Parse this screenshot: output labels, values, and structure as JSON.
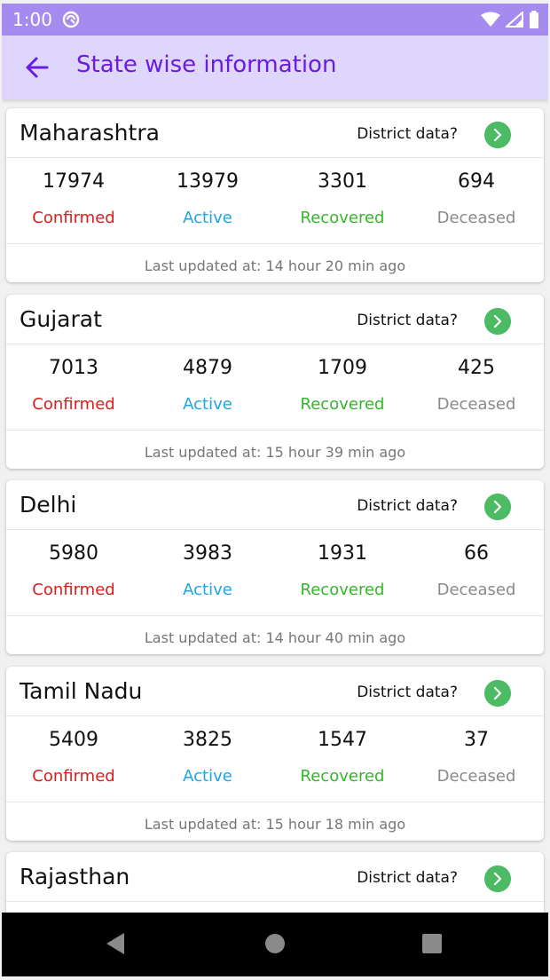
{
  "status_bar": {
    "time": "1:00"
  },
  "app_bar": {
    "title": "State wise information"
  },
  "district_label": "District data?",
  "stat_labels": {
    "confirmed": "Confirmed",
    "active": "Active",
    "recovered": "Recovered",
    "deceased": "Deceased"
  },
  "states": [
    {
      "name": "Maharashtra",
      "confirmed": "17974",
      "active": "13979",
      "recovered": "3301",
      "deceased": "694",
      "updated": "Last updated at: 14 hour 20 min ago"
    },
    {
      "name": "Gujarat",
      "confirmed": "7013",
      "active": "4879",
      "recovered": "1709",
      "deceased": "425",
      "updated": "Last updated at: 15 hour 39 min ago"
    },
    {
      "name": "Delhi",
      "confirmed": "5980",
      "active": "3983",
      "recovered": "1931",
      "deceased": "66",
      "updated": "Last updated at: 14 hour 40 min ago"
    },
    {
      "name": "Tamil Nadu",
      "confirmed": "5409",
      "active": "3825",
      "recovered": "1547",
      "deceased": "37",
      "updated": "Last updated at: 15 hour 18 min ago"
    },
    {
      "name": "Rajasthan"
    }
  ],
  "colors": {
    "status_bar": "#a58af0",
    "app_bar": "#ded6fb",
    "title": "#6a1be6",
    "confirmed": "#e01b1b",
    "active": "#1ba6e6",
    "recovered": "#35b52b",
    "deceased": "#8a8a8a",
    "district_button": "#4cbb64"
  }
}
